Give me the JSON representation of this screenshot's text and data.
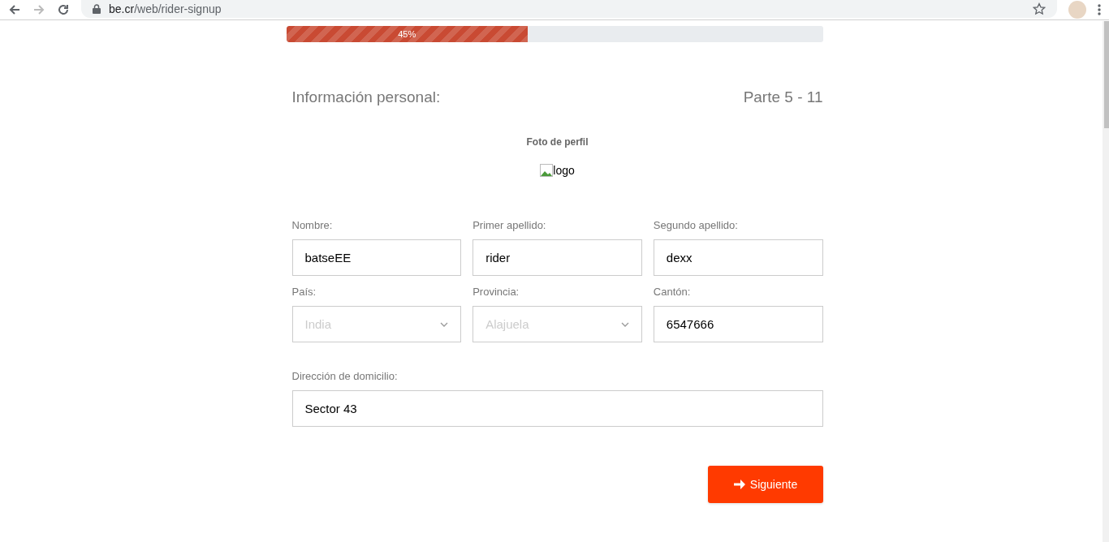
{
  "browser": {
    "url_host": "be.cr",
    "url_path": "/web/rider-signup"
  },
  "progress": {
    "level": 0.45,
    "label": "45%"
  },
  "header": {
    "title": "Información personal:",
    "step": "Parte 5 - 11"
  },
  "photo": {
    "label": "Foto de perfil",
    "alt": "logo"
  },
  "fields": [
    {
      "label": "Nombre:",
      "kind": "text",
      "value": "batseEE",
      "disabled": false
    },
    {
      "label": "Primer apellido:",
      "kind": "text",
      "value": "rider",
      "disabled": false
    },
    {
      "label": "Segundo apellido:",
      "kind": "text",
      "value": "dexx",
      "disabled": false
    },
    {
      "label": "País:",
      "kind": "select",
      "value": "India",
      "disabled": true
    },
    {
      "label": "Provincia:",
      "kind": "select",
      "value": "Alajuela",
      "disabled": true
    },
    {
      "label": "Cantón:",
      "kind": "text",
      "value": "6547666",
      "disabled": false
    }
  ],
  "address": {
    "label": "Dirección de domicilio:",
    "value": "Sector 43"
  },
  "next_button": {
    "label": "Siguiente"
  }
}
